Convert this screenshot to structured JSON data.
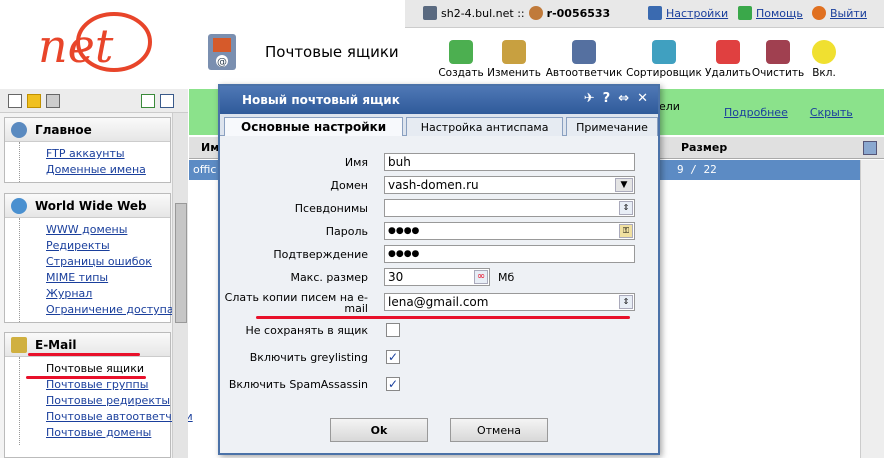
{
  "topbar": {
    "server": "sh2-4.bul.net ::",
    "account": "r-0056533",
    "settings": "Настройки",
    "help": "Помощь",
    "logout": "Выйти"
  },
  "logo": {
    "text": "net"
  },
  "page": {
    "title": "Почтовые ящики"
  },
  "toolbar": {
    "items": [
      "Создать",
      "Изменить",
      "Автоответчик",
      "Сортировщик",
      "Удалить",
      "Очистить",
      "Вкл."
    ]
  },
  "sidebar": {
    "sections": [
      {
        "title": "Главное",
        "items": [
          "FTP аккаунты",
          "Доменные имена"
        ]
      },
      {
        "title": "World Wide Web",
        "items": [
          "WWW домены",
          "Редиректы",
          "Страницы ошибок",
          "MIME типы",
          "Журнал",
          "Ограничение доступа"
        ]
      },
      {
        "title": "E-Mail",
        "items": [
          "Почтовые ящики",
          "Почтовые группы",
          "Почтовые редиректы",
          "Почтовые автоответчики",
          "Почтовые домены"
        ]
      }
    ]
  },
  "main": {
    "strip_text": "ели",
    "links": [
      "Подробнее",
      "Скрыть"
    ],
    "headers": [
      "Им",
      "Размер"
    ],
    "row": {
      "name": "offic",
      "size": "9 / 22"
    }
  },
  "dialog": {
    "title": "Новый почтовый ящик",
    "tabs": [
      "Основные настройки",
      "Настройка антиспама",
      "Примечание"
    ],
    "fields": {
      "name_label": "Имя",
      "name_value": "buh",
      "domain_label": "Домен",
      "domain_value": "vash-domen.ru",
      "alias_label": "Псевдонимы",
      "password_label": "Пароль",
      "password_value": "●●●●",
      "confirm_label": "Подтверждение",
      "confirm_value": "●●●●",
      "maxsize_label": "Макс. размер",
      "maxsize_value": "30",
      "maxsize_unit": "Мб",
      "copy_label": "Слать копии писем на e-mail",
      "copy_value": "lena@gmail.com",
      "nosave_label": "Не сохранять в ящик",
      "grey_label": "Включить greylisting",
      "spam_label": "Включить SpamAssassin"
    },
    "checks": {
      "nosave": false,
      "grey": true,
      "spam": true
    },
    "ok": "Ok",
    "cancel": "Отмена"
  },
  "colors": {
    "accent": "#e8102a",
    "titlebar": "#3a64a6",
    "strip": "#8be28b"
  }
}
